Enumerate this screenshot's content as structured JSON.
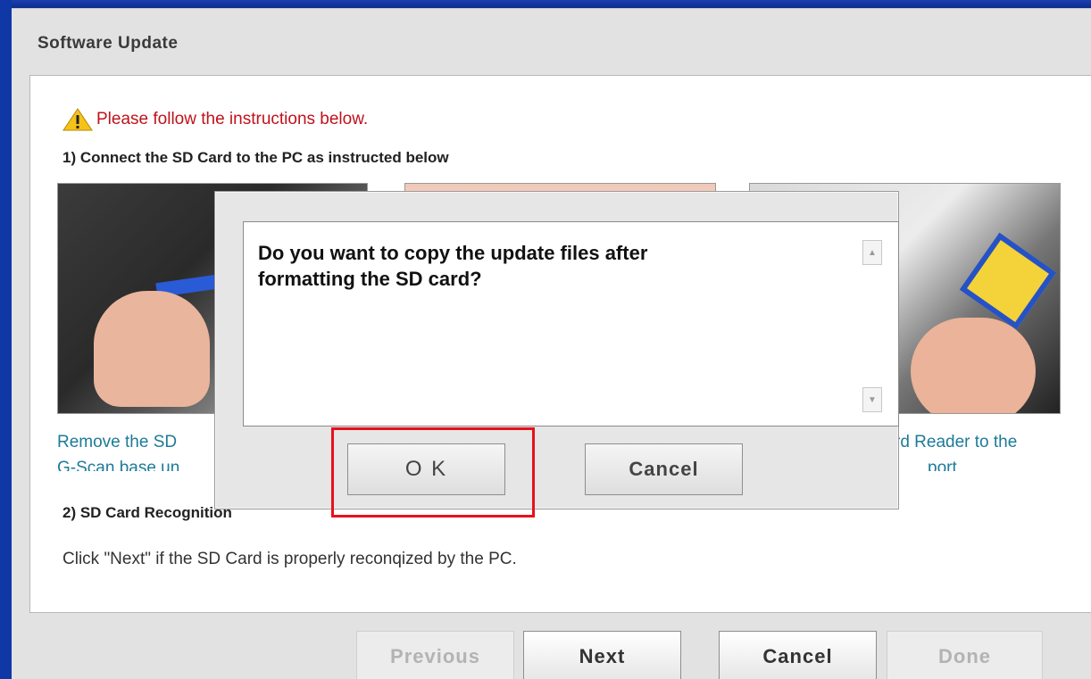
{
  "window": {
    "title": "Software Update"
  },
  "content": {
    "warning": "Please follow the instructions below.",
    "step1_heading": "1) Connect the SD Card to the PC as instructed below",
    "captions": {
      "left_line1": "Remove the SD",
      "left_line2": "G-Scan base un",
      "right_line1": "rd Reader to the",
      "right_line2": "port"
    },
    "step2_heading": "2) SD Card Recognition",
    "step2_desc": "Click \"Next\" if the SD Card is properly reconqized by the PC."
  },
  "buttons": {
    "previous": "Previous",
    "next": "Next",
    "cancel": "Cancel",
    "done": "Done"
  },
  "dialog": {
    "message_line1": "Do you want to copy the update files after",
    "message_line2": "formatting the SD card?",
    "ok": "O K",
    "cancel": "Cancel"
  },
  "colors": {
    "warning_text": "#c0121b",
    "caption_text": "#1c7b98",
    "highlight": "#e8101a"
  }
}
